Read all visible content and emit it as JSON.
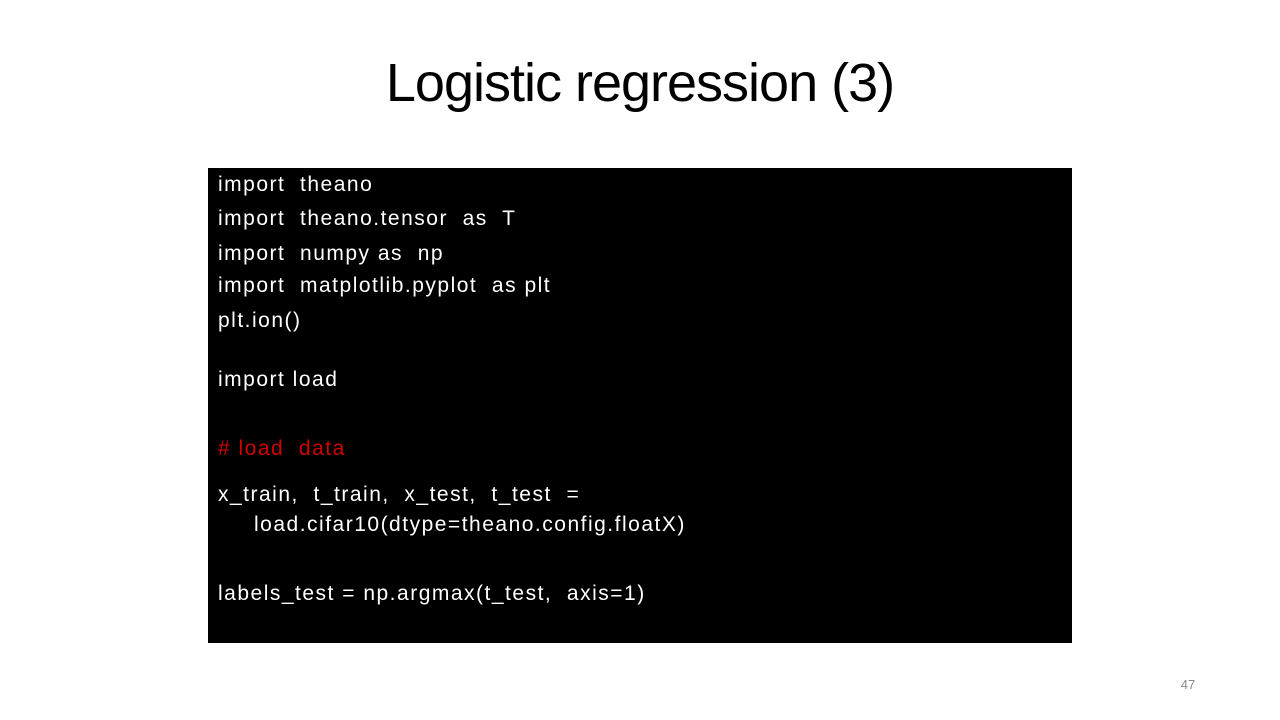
{
  "slide": {
    "title": "Logistic regression (3)",
    "page_number": "47"
  },
  "code": {
    "lines": [
      "import  theano",
      "import  theano.tensor  as  T",
      "import  numpy as  np",
      "import  matplotlib.pyplot  as plt",
      "plt.ion()",
      "import load",
      "# load  data",
      "x_train,  t_train,  x_test,  t_test  =",
      "load.cifar10(dtype=theano.config.floatX)",
      "labels_test = np.argmax(t_test,  axis=1)"
    ],
    "comment_color": "#d00000",
    "text_color": "#ffffff",
    "background_color": "#000000"
  }
}
